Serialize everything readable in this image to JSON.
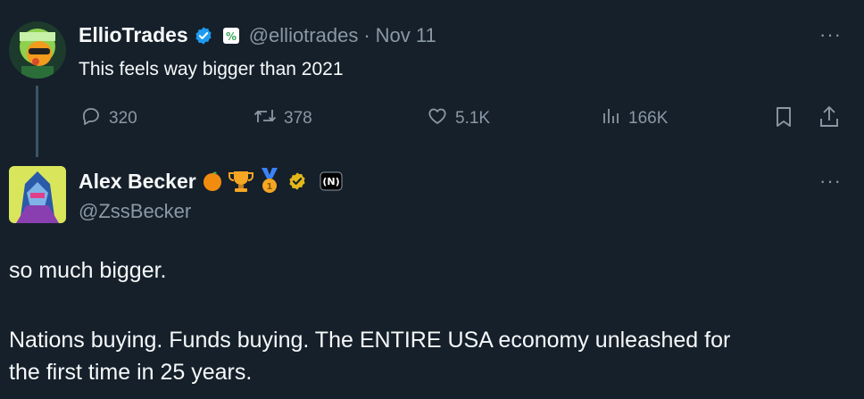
{
  "tweet1": {
    "name": "EllioTrades",
    "handle": "@elliotrades",
    "separator": "·",
    "date": "Nov 11",
    "text": "This feels way bigger than 2021",
    "more": "···",
    "actions": {
      "replies": "320",
      "retweets": "378",
      "likes": "5.1K",
      "views": "166K"
    }
  },
  "tweet2": {
    "name": "Alex Becker",
    "handle": "@ZssBecker",
    "more": "···",
    "paragraph1": "so much bigger.",
    "paragraph2_line1": "Nations buying. Funds buying. The ENTIRE USA economy unleashed for",
    "paragraph2_line2": "the first time in 25 years."
  },
  "colors": {
    "background": "#15202b",
    "text": "#f7f9f9",
    "muted": "#8b98a5",
    "verified_blue": "#1d9bf0",
    "verified_gold": "#e2b719"
  },
  "icons": [
    "reply-icon",
    "retweet-icon",
    "like-icon",
    "views-icon",
    "bookmark-icon",
    "share-icon",
    "verified-icon",
    "more-icon"
  ]
}
